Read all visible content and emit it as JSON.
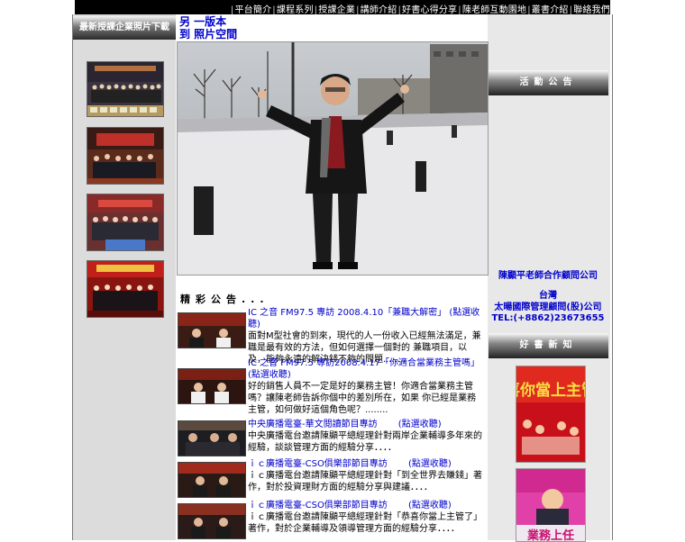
{
  "topnav": {
    "items": [
      "平台簡介",
      "課程系列",
      "授課企業",
      "講師介紹",
      "好書心得分享",
      "陳老師互動園地",
      "叢書介紹",
      "聯絡我們"
    ]
  },
  "left": {
    "header": "最新授課企業照片下載"
  },
  "center": {
    "title_line1": "另 一版本",
    "title_line2": "到 照片空間",
    "news_title": "精彩公告...",
    "news": [
      {
        "head": "IC 之音 FM97.5 專訪 2008.4.10「兼職大解密」 (點選收聽)",
        "body": "面對M型社會的到來，現代的人一份收入已經無法滿足，兼職是最有效的方法，但如何選擇一個對的 兼職項目，以及，能夠永遠的解決錢不夠的問題........"
      },
      {
        "head": "IC 之音 FM97.5 專訪2008.4.17「你適合當業務主管嗎」 (點選收聽)",
        "body": "好的銷售人員不一定是好的業務主管！你適合當業務主管嗎？讓陳老師告訴你個中的差別所在，如果 你已經是業務主管，如何做好這個角色呢？........"
      },
      {
        "head": "中央廣播電臺-華文閱讀節目專訪 　　(點選收聽)",
        "body": "中央廣播電台邀請陳顯平總經理針對兩岸企業輔導多年來的經驗，談談管理方面的經驗分享．．．．"
      },
      {
        "head": "ｉｃ廣播電臺-CSO俱樂部節目專訪 　　(點選收聽)",
        "body": "ｉｃ廣播電台邀請陳顯平總經理針對「到全世界去賺錢」著作，對於投資理財方面的經驗分享與建議．．．．"
      },
      {
        "head": "ｉｃ廣播電臺-CSO俱樂部節目專訪 　　(點選收聽)",
        "body": "ｉｃ廣播電台邀請陳顯平總經理針對「恭喜你當上主管了」著作，對於企業輔導及領導管理方面的經驗分享．．．．"
      }
    ]
  },
  "right": {
    "header1": "活動公告",
    "partner1": "陳顯平老師合作顧問公司",
    "partner2": "台灣",
    "partner3": "太暘國際管理顧問(股)公司",
    "partner4": "TEL:(+8862)23673655",
    "header2": "好書新知",
    "book1_title": "恭喜你當上主管了",
    "book2_title": "業務上任"
  },
  "colors": {
    "link": "#0000cc",
    "topbar": "#000000",
    "leftcol": "#dcdcdc",
    "rightcol": "#e8e8e8"
  }
}
